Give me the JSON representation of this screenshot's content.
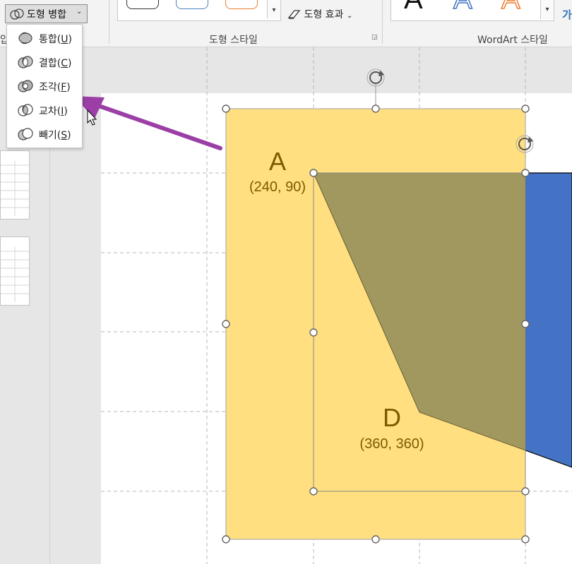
{
  "ribbon": {
    "merge_button_label": "도형 병합",
    "shape_effects_label": "도형 효과",
    "shape_styles_group": "도형 스타일",
    "wordart_group": "WordArt 스타일",
    "left_cut_label": "압",
    "wordart_cut_label": "가"
  },
  "merge_menu": {
    "items": [
      {
        "label": "통합",
        "key": "U"
      },
      {
        "label": "결합",
        "key": "C"
      },
      {
        "label": "조각",
        "key": "F"
      },
      {
        "label": "교차",
        "key": "I"
      },
      {
        "label": "빼기",
        "key": "S"
      }
    ]
  },
  "slide": {
    "point_a": {
      "name": "A",
      "coords": "(240, 90)"
    },
    "point_d": {
      "name": "D",
      "coords": "(360, 360)"
    }
  },
  "colors": {
    "yellow_shape": "#ffdf80",
    "overlap_region": "#a0985f",
    "blue_shape": "#4472c4",
    "annotation_arrow": "#9b3fa7",
    "label_text": "#7a5c00"
  }
}
